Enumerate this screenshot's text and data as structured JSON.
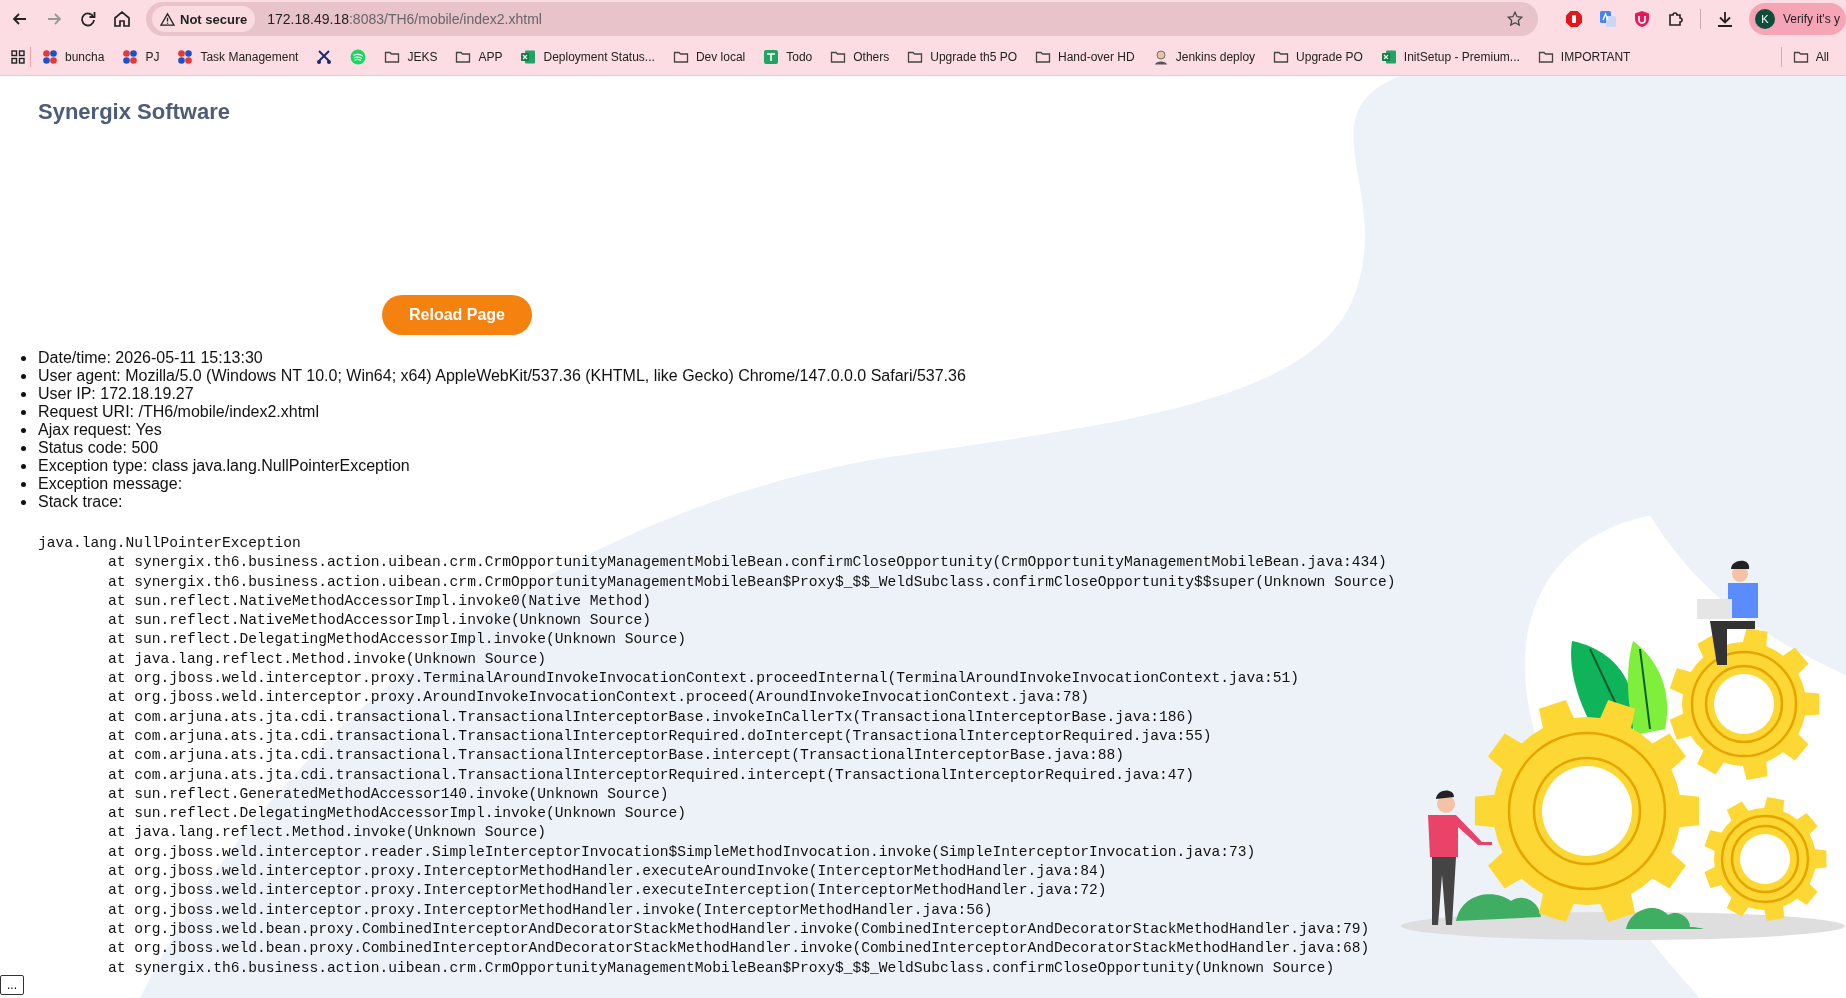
{
  "browser": {
    "security": "Not secure",
    "url_host": "172.18.49.18",
    "url_rest": ":8083/TH6/mobile/index2.xhtml",
    "profile": {
      "initial": "K",
      "label": "Verify it's y"
    }
  },
  "bookmarks": [
    {
      "kind": "people",
      "label": "buncha"
    },
    {
      "kind": "people",
      "label": "PJ"
    },
    {
      "kind": "people",
      "label": "Task Management"
    },
    {
      "kind": "tool"
    },
    {
      "kind": "music"
    },
    {
      "kind": "folder",
      "label": "JEKS"
    },
    {
      "kind": "folder",
      "label": "APP"
    },
    {
      "kind": "sheet",
      "label": "Deployment Status..."
    },
    {
      "kind": "folder",
      "label": "Dev local"
    },
    {
      "kind": "todo",
      "label": "Todo"
    },
    {
      "kind": "folder",
      "label": "Others"
    },
    {
      "kind": "folder",
      "label": "Upgrade th5 PO"
    },
    {
      "kind": "folder",
      "label": "Hand-over HD"
    },
    {
      "kind": "person",
      "label": "Jenkins deploy"
    },
    {
      "kind": "folder",
      "label": "Upgrade PO"
    },
    {
      "kind": "sheet",
      "label": "InitSetup - Premium..."
    },
    {
      "kind": "folder",
      "label": "IMPORTANT"
    }
  ],
  "all_bookmarks": "All",
  "page": {
    "title": "Synergix Software",
    "reload_button": "Reload Page",
    "info": [
      "Date/time: 2026-05-11 15:13:30",
      "User agent: Mozilla/5.0 (Windows NT 10.0; Win64; x64) AppleWebKit/537.36 (KHTML, like Gecko) Chrome/147.0.0.0 Safari/537.36",
      "User IP: 172.18.19.27",
      "Request URI: /TH6/mobile/index2.xhtml",
      "Ajax request: Yes",
      "Status code: 500",
      "Exception type: class java.lang.NullPointerException",
      "Exception message:",
      "Stack trace:"
    ],
    "stack_trace": [
      "java.lang.NullPointerException",
      "\tat synergix.th6.business.action.uibean.crm.CrmOpportunityManagementMobileBean.confirmCloseOpportunity(CrmOpportunityManagementMobileBean.java:434)",
      "\tat synergix.th6.business.action.uibean.crm.CrmOpportunityManagementMobileBean$Proxy$_$$_WeldSubclass.confirmCloseOpportunity$$super(Unknown Source)",
      "\tat sun.reflect.NativeMethodAccessorImpl.invoke0(Native Method)",
      "\tat sun.reflect.NativeMethodAccessorImpl.invoke(Unknown Source)",
      "\tat sun.reflect.DelegatingMethodAccessorImpl.invoke(Unknown Source)",
      "\tat java.lang.reflect.Method.invoke(Unknown Source)",
      "\tat org.jboss.weld.interceptor.proxy.TerminalAroundInvokeInvocationContext.proceedInternal(TerminalAroundInvokeInvocationContext.java:51)",
      "\tat org.jboss.weld.interceptor.proxy.AroundInvokeInvocationContext.proceed(AroundInvokeInvocationContext.java:78)",
      "\tat com.arjuna.ats.jta.cdi.transactional.TransactionalInterceptorBase.invokeInCallerTx(TransactionalInterceptorBase.java:186)",
      "\tat com.arjuna.ats.jta.cdi.transactional.TransactionalInterceptorRequired.doIntercept(TransactionalInterceptorRequired.java:55)",
      "\tat com.arjuna.ats.jta.cdi.transactional.TransactionalInterceptorBase.intercept(TransactionalInterceptorBase.java:88)",
      "\tat com.arjuna.ats.jta.cdi.transactional.TransactionalInterceptorRequired.intercept(TransactionalInterceptorRequired.java:47)",
      "\tat sun.reflect.GeneratedMethodAccessor140.invoke(Unknown Source)",
      "\tat sun.reflect.DelegatingMethodAccessorImpl.invoke(Unknown Source)",
      "\tat java.lang.reflect.Method.invoke(Unknown Source)",
      "\tat org.jboss.weld.interceptor.reader.SimpleInterceptorInvocation$SimpleMethodInvocation.invoke(SimpleInterceptorInvocation.java:73)",
      "\tat org.jboss.weld.interceptor.proxy.InterceptorMethodHandler.executeAroundInvoke(InterceptorMethodHandler.java:84)",
      "\tat org.jboss.weld.interceptor.proxy.InterceptorMethodHandler.executeInterception(InterceptorMethodHandler.java:72)",
      "\tat org.jboss.weld.interceptor.proxy.InterceptorMethodHandler.invoke(InterceptorMethodHandler.java:56)",
      "\tat org.jboss.weld.bean.proxy.CombinedInterceptorAndDecoratorStackMethodHandler.invoke(CombinedInterceptorAndDecoratorStackMethodHandler.java:79)",
      "\tat org.jboss.weld.bean.proxy.CombinedInterceptorAndDecoratorStackMethodHandler.invoke(CombinedInterceptorAndDecoratorStackMethodHandler.java:68)",
      "\tat synergix.th6.business.action.uibean.crm.CrmOpportunityManagementMobileBean$Proxy$_$$_WeldSubclass.confirmCloseOpportunity(Unknown Source)"
    ],
    "more_button": "..."
  }
}
